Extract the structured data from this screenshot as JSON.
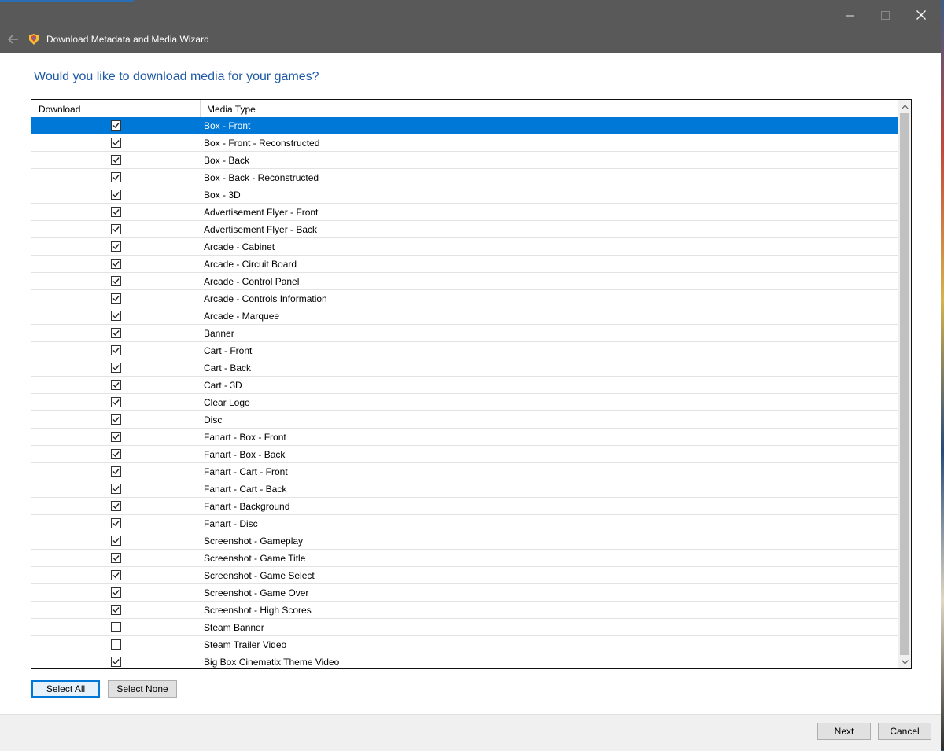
{
  "window": {
    "title": "Download Metadata and Media Wizard"
  },
  "question": "Would you like to download media for your games?",
  "grid": {
    "columns": {
      "download": "Download",
      "media_type": "Media Type"
    },
    "rows": [
      {
        "label": "Box - Front",
        "checked": true
      },
      {
        "label": "Box - Front - Reconstructed",
        "checked": true
      },
      {
        "label": "Box - Back",
        "checked": true
      },
      {
        "label": "Box - Back - Reconstructed",
        "checked": true
      },
      {
        "label": "Box - 3D",
        "checked": true
      },
      {
        "label": "Advertisement Flyer - Front",
        "checked": true
      },
      {
        "label": "Advertisement Flyer - Back",
        "checked": true
      },
      {
        "label": "Arcade - Cabinet",
        "checked": true
      },
      {
        "label": "Arcade - Circuit Board",
        "checked": true
      },
      {
        "label": "Arcade - Control Panel",
        "checked": true
      },
      {
        "label": "Arcade - Controls Information",
        "checked": true
      },
      {
        "label": "Arcade - Marquee",
        "checked": true
      },
      {
        "label": "Banner",
        "checked": true
      },
      {
        "label": "Cart - Front",
        "checked": true
      },
      {
        "label": "Cart - Back",
        "checked": true
      },
      {
        "label": "Cart - 3D",
        "checked": true
      },
      {
        "label": "Clear Logo",
        "checked": true
      },
      {
        "label": "Disc",
        "checked": true
      },
      {
        "label": "Fanart - Box - Front",
        "checked": true
      },
      {
        "label": "Fanart - Box - Back",
        "checked": true
      },
      {
        "label": "Fanart - Cart - Front",
        "checked": true
      },
      {
        "label": "Fanart - Cart - Back",
        "checked": true
      },
      {
        "label": "Fanart - Background",
        "checked": true
      },
      {
        "label": "Fanart - Disc",
        "checked": true
      },
      {
        "label": "Screenshot - Gameplay",
        "checked": true
      },
      {
        "label": "Screenshot - Game Title",
        "checked": true
      },
      {
        "label": "Screenshot - Game Select",
        "checked": true
      },
      {
        "label": "Screenshot - Game Over",
        "checked": true
      },
      {
        "label": "Screenshot - High Scores",
        "checked": true
      },
      {
        "label": "Steam Banner",
        "checked": false
      },
      {
        "label": "Steam Trailer Video",
        "checked": false
      },
      {
        "label": "Big Box Cinematix Theme Video",
        "checked": true
      }
    ],
    "selected_row": 0
  },
  "buttons": {
    "select_all": "Select All",
    "select_none": "Select None",
    "next": "Next",
    "cancel": "Cancel"
  },
  "icons": {
    "back": "back-arrow-icon",
    "app": "launchbox-app-icon",
    "minimize": "minimize-icon",
    "maximize": "maximize-icon",
    "close": "close-icon",
    "checkbox": "checkmark-icon",
    "scroll_up": "chevron-up-icon",
    "scroll_down": "chevron-down-icon"
  },
  "colors": {
    "titlebar": "#595959",
    "selection": "#0078d7",
    "heading": "#1f5aa6"
  }
}
